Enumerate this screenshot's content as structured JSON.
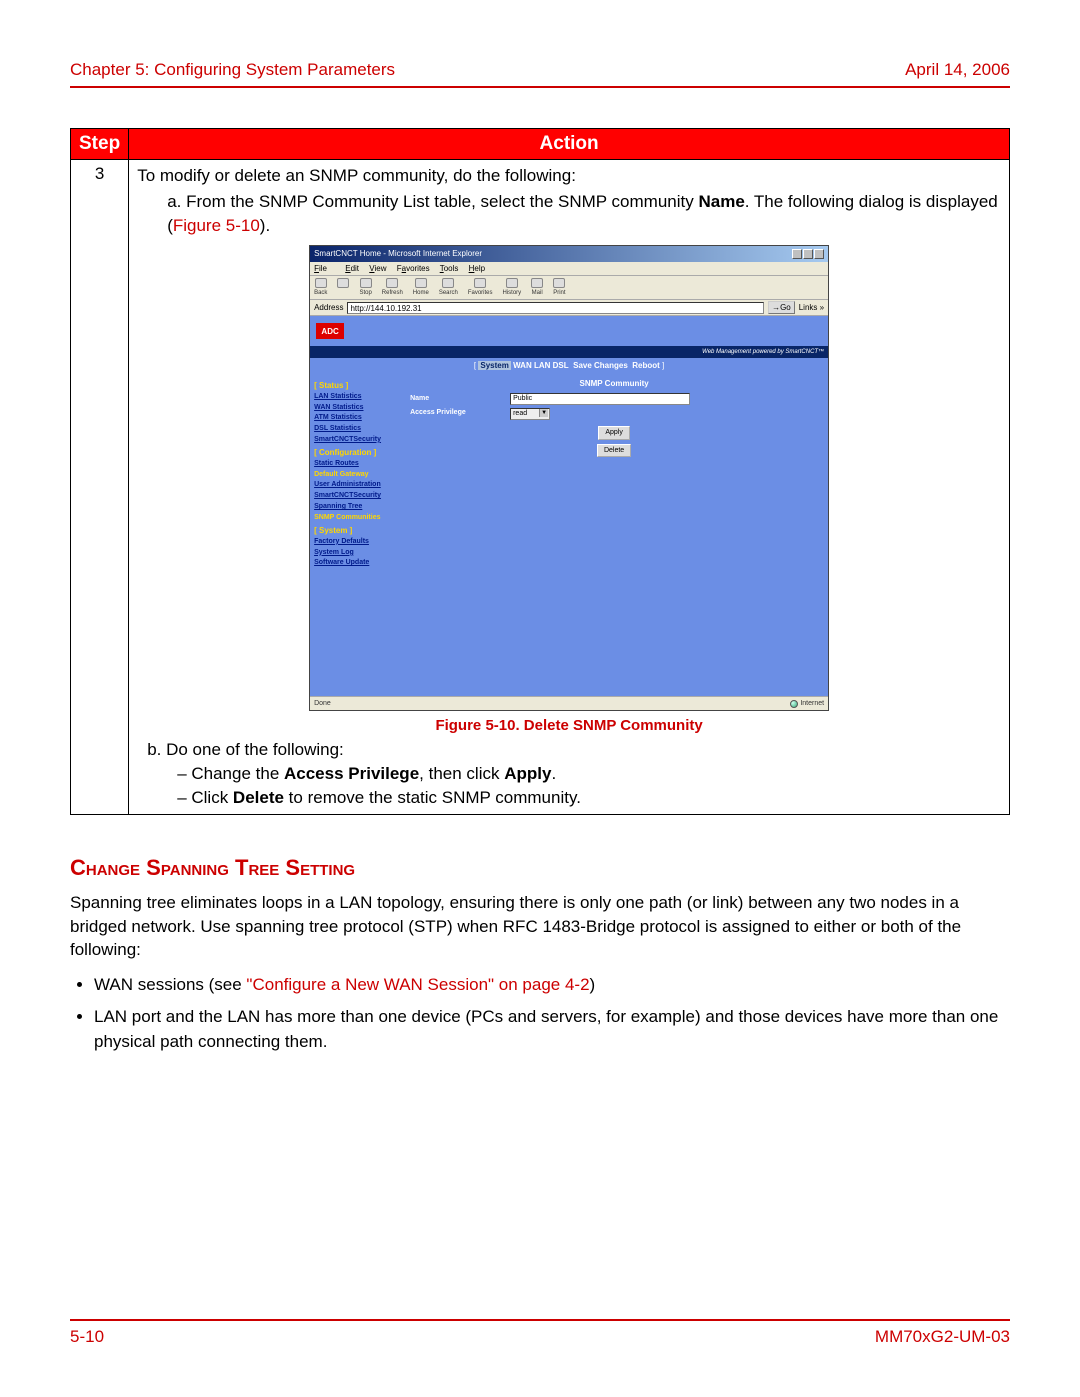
{
  "header": {
    "left": "Chapter 5: Configuring System Parameters",
    "right": "April 14, 2006"
  },
  "footer": {
    "left": "5-10",
    "right": "MM70xG2-UM-03"
  },
  "table": {
    "head_step": "Step",
    "head_action": "Action",
    "step": "3",
    "intro": "To modify or delete an SNMP community, do the following:",
    "a_prefix": "a. From the SNMP Community List table, select the SNMP community ",
    "a_bold": "Name",
    "a_suffix": ". The following dialog is displayed (",
    "a_figref": "Figure 5-10",
    "a_close": ").",
    "caption": "Figure 5-10. Delete SNMP Community",
    "b_intro": "b. Do one of the following:",
    "dash1_pre": "– Change the ",
    "dash1_b1": "Access Privilege",
    "dash1_mid": ", then click ",
    "dash1_b2": "Apply",
    "dash1_end": ".",
    "dash2_pre": "– Click ",
    "dash2_b": "Delete",
    "dash2_end": " to remove the static SNMP community."
  },
  "ie": {
    "title": "SmartCNCT Home - Microsoft Internet Explorer",
    "menu": {
      "file": "File",
      "edit": "Edit",
      "view": "View",
      "favorites": "Favorites",
      "tools": "Tools",
      "help": "Help"
    },
    "toolbar": {
      "back": "Back",
      "fwd": " ",
      "stop": "Stop",
      "refresh": "Refresh",
      "home": "Home",
      "search": "Search",
      "favorites": "Favorites",
      "history": "History",
      "mail": "Mail",
      "print": "Print"
    },
    "addr_label": "Address",
    "addr_value": "http://144.10.192.31",
    "go": "Go",
    "links": "Links »",
    "status_left": "Done",
    "status_right": "Internet"
  },
  "adc": {
    "logo": "ADC",
    "tagline": "Web Management powered by SmartCNCT™",
    "nav": {
      "system": "System",
      "wan": "WAN",
      "lan": "LAN",
      "dsl": "DSL",
      "save": "Save Changes",
      "reboot": "Reboot"
    },
    "left": {
      "h1": "[ Status ]",
      "lan": "LAN Statistics",
      "wan": "WAN Statistics",
      "atm": "ATM Statistics",
      "dsl": "DSL Statistics",
      "sec1": "SmartCNCTSecurity",
      "h2": "[ Configuration ]",
      "routes": "Static Routes",
      "gw": "Default Gateway",
      "useradm": "User Administration",
      "sec2": "SmartCNCTSecurity",
      "span": "Spanning Tree",
      "snmp": "SNMP Communities",
      "h3": "[ System ]",
      "factory": "Factory Defaults",
      "syslog": "System Log",
      "softup": "Software Update"
    },
    "panel": {
      "title": "SNMP Community",
      "name_lbl": "Name",
      "name_val": "Public",
      "priv_lbl": "Access Privilege",
      "priv_val": "read",
      "apply": "Apply",
      "delete": "Delete"
    }
  },
  "section": {
    "heading": "Change Spanning Tree Setting",
    "para": "Spanning tree eliminates loops in a LAN topology, ensuring there is only one path (or link) between any two nodes in a bridged network. Use spanning tree protocol (STP) when RFC 1483-Bridge protocol is assigned to either or both of the following:",
    "b1_pre": "WAN sessions (see ",
    "b1_link": "\"Configure a New WAN Session\" on page 4-2",
    "b1_post": ")",
    "b2": "LAN port and the LAN has more than one device (PCs and servers, for example) and those devices have more than one physical path connecting them."
  }
}
